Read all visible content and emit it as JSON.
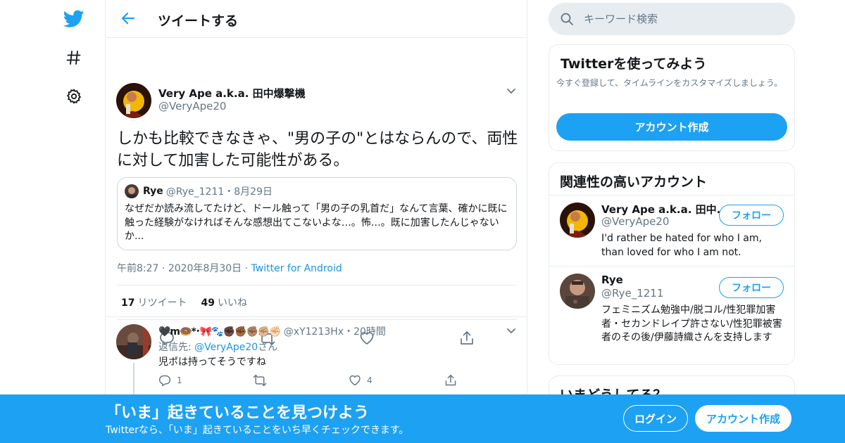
{
  "nav": {
    "logo_icon": "twitter-bird-icon",
    "explore_icon": "hashtag-icon",
    "settings_icon": "gear-icon"
  },
  "header": {
    "title": "ツイートする",
    "back_icon": "arrow-left-icon"
  },
  "tweet": {
    "author_name": "Very Ape a.k.a. 田中爆撃機",
    "author_handle": "@VeryApe20",
    "text": "しかも比較できなきゃ、\"男の子の\"とはならんので、両性に対して加害した可能性がある。",
    "quote": {
      "name": "Rye",
      "meta": "@Rye_1211・8月29日",
      "text": "なぜだか読み流してたけど、ドール触って「男の子の乳首だ」なんて言葉、確かに既に触った経験がなければそんな感想出てこないよな…。怖…。既に加害したんじゃないか..."
    },
    "time": "午前8:27",
    "date": "2020年8月30日",
    "client": "Twitter for Android",
    "retweets_count": "17",
    "retweets_label": "リツイート",
    "likes_count": "49",
    "likes_label": "いいね"
  },
  "reply": {
    "name": "🖤m🍩*･🎀🐾✊🏿✊🏾✊🏽✊🏼✊🏻",
    "meta": "@xY1213Hx・20時間",
    "reply_to_prefix": "返信先: ",
    "reply_to_link": "@VeryApe20",
    "reply_to_suffix": "さん",
    "text": "児ポは持ってそうですね",
    "reply_count": "1",
    "retweet_count": "",
    "like_count": "4"
  },
  "sidebar": {
    "search_placeholder": "キーワード検索",
    "signup": {
      "title": "Twitterを使ってみよう",
      "desc": "今すぐ登録して、タイムラインをカスタマイズしましょう。",
      "button": "アカウント作成"
    },
    "related": {
      "title": "関連性の高いアカウント",
      "accounts": [
        {
          "name": "Very Ape a.k.a. 田中...",
          "handle": "@VeryApe20",
          "bio": "I'd rather be hated for who I am, than loved for who I am not.",
          "follow": "フォロー"
        },
        {
          "name": "Rye",
          "handle": "@Rye_1211",
          "bio": "フェミニズム勉強中/脱コル/性犯罪加害者・セカンドレイプ許さない/性犯罪被害者のその後/伊藤詩織さんを支持します",
          "follow": "フォロー"
        }
      ]
    },
    "whatsup_title": "いまどうしてる？"
  },
  "bottom_bar": {
    "title": "「いま」起きていることを見つけよう",
    "subtitle": "Twitterなら、「いま」起きていることをいち早くチェックできます。",
    "login": "ログイン",
    "signup": "アカウント作成"
  },
  "colors": {
    "accent": "#1da1f2",
    "link": "#1b95e0",
    "secondary_text": "#657786",
    "border": "#e6ecf0"
  }
}
